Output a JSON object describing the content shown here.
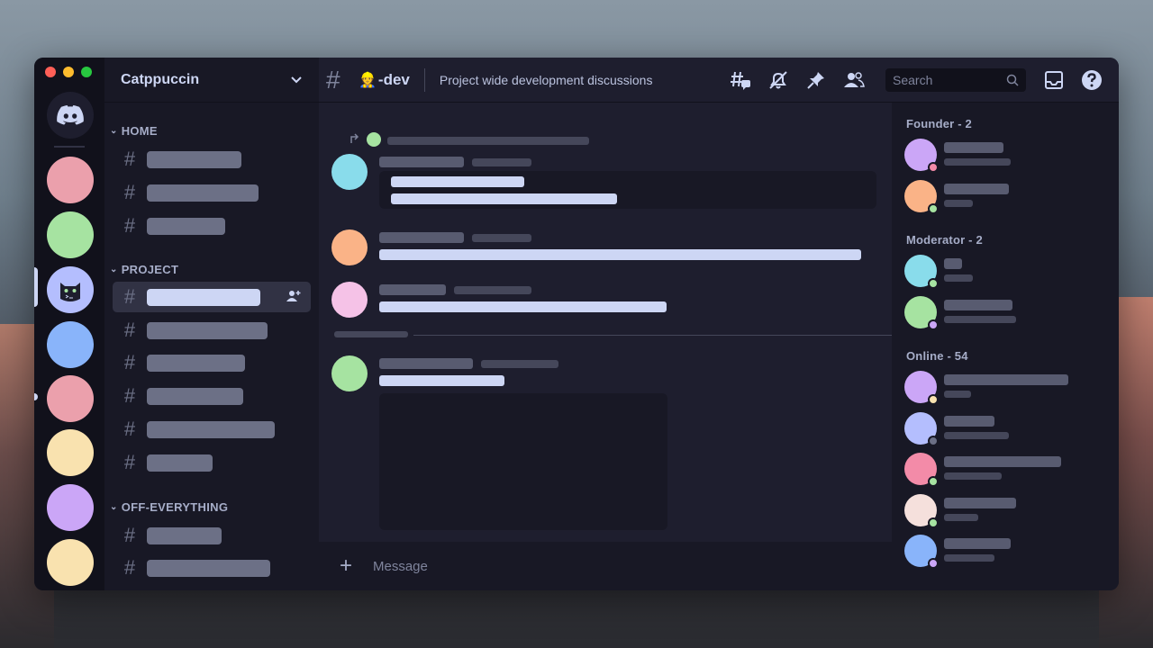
{
  "colors": {
    "crust": "#11111b",
    "mantle": "#181825",
    "base": "#1e1e2e",
    "surface0": "#313244",
    "text": "#cdd6f4",
    "lavender": "#b4befe",
    "red": "#ed8796",
    "green": "#a6e3a1",
    "yellow": "#f9e2af",
    "mauve": "#cba6f7",
    "sky": "#89dceb",
    "peach": "#fab387",
    "pink": "#f5c2e7",
    "blue": "#89b4fa"
  },
  "window": {
    "traffic_lights": [
      "#ff5f57",
      "#febc2e",
      "#28c840"
    ]
  },
  "rail": {
    "home_icon": "discord-logo-icon",
    "servers": [
      {
        "color": "#eba0ac"
      },
      {
        "color": "#a6e3a1"
      },
      {
        "color": "#b4befe",
        "selected": true,
        "icon": "catppuccin-cat-icon"
      },
      {
        "color": "#89b4fa"
      },
      {
        "color": "#eba0ac",
        "unread": true
      },
      {
        "color": "#f9e2af"
      },
      {
        "color": "#cba6f7"
      },
      {
        "color": "#f9e2af"
      }
    ]
  },
  "guild": {
    "name": "Catppuccin",
    "dropdown_icon": "chevron-down-icon"
  },
  "categories": [
    {
      "label": "HOME"
    },
    {
      "label": "PROJECT"
    },
    {
      "label": "OFF-EVERYTHING"
    }
  ],
  "topbar": {
    "channel_name": "-dev",
    "channel_emoji": "👷",
    "topic": "Project wide development discussions",
    "search_placeholder": "Search",
    "icons": [
      "threads-icon",
      "mute-bell-icon",
      "pin-icon",
      "members-icon",
      "inbox-icon",
      "help-icon"
    ]
  },
  "composer": {
    "placeholder": "Message",
    "add_icon": "plus-icon"
  },
  "members": {
    "groups": [
      {
        "label": "Founder - 2"
      },
      {
        "label": "Moderator - 2"
      },
      {
        "label": "Online - 54"
      }
    ],
    "list": [
      {
        "avatar": "#cba6f7",
        "status": "#f38ba8"
      },
      {
        "avatar": "#fab387",
        "status": "#a6e3a1"
      },
      {
        "avatar": "#89dceb",
        "status": "#a6e3a1"
      },
      {
        "avatar": "#a6e3a1",
        "status": "#cba6f7"
      },
      {
        "avatar": "#cba6f7",
        "status": "#f9e2af"
      },
      {
        "avatar": "#b4befe",
        "status": "#6c7086"
      },
      {
        "avatar": "#f38ba8",
        "status": "#a6e3a1"
      },
      {
        "avatar": "#f5e0dc",
        "status": "#a6e3a1"
      },
      {
        "avatar": "#89b4fa",
        "status": "#cba6f7"
      }
    ]
  }
}
